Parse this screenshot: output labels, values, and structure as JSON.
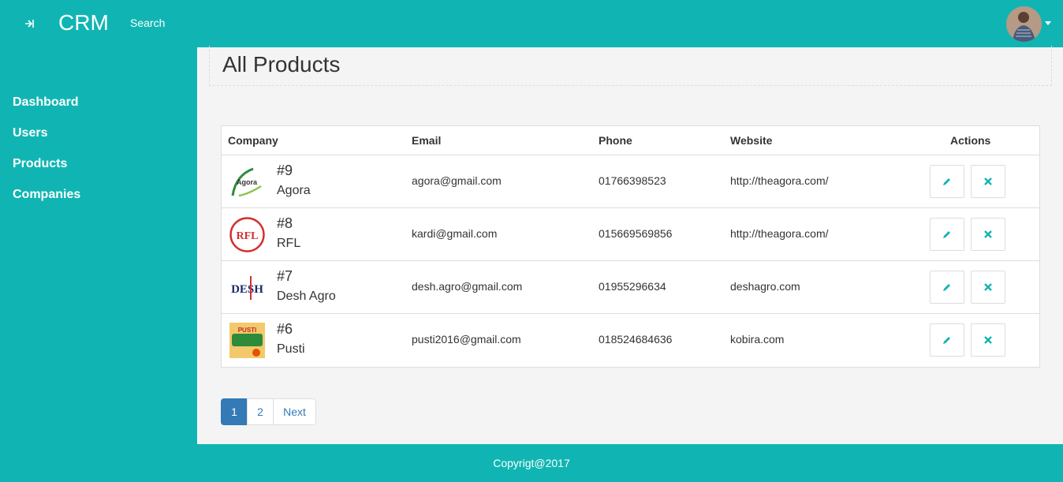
{
  "header": {
    "brand": "CRM",
    "search_label": "Search"
  },
  "colors": {
    "accent": "#10b5b3",
    "primary": "#337ab7"
  },
  "sidebar": {
    "items": [
      {
        "label": "Dashboard"
      },
      {
        "label": "Users"
      },
      {
        "label": "Products"
      },
      {
        "label": "Companies"
      }
    ]
  },
  "main": {
    "title": "All Products",
    "columns": [
      "Company",
      "Email",
      "Phone",
      "Website",
      "Actions"
    ],
    "rows": [
      {
        "id": "#9",
        "name": "Agora",
        "logo_text": "Agora",
        "email": "agora@gmail.com",
        "phone": "01766398523",
        "website": "http://theagora.com/"
      },
      {
        "id": "#8",
        "name": "RFL",
        "logo_text": "RFL",
        "email": "kardi@gmail.com",
        "phone": "015669569856",
        "website": "http://theagora.com/"
      },
      {
        "id": "#7",
        "name": "Desh Agro",
        "logo_text": "DESH",
        "email": "desh.agro@gmail.com",
        "phone": "01955296634",
        "website": "deshagro.com"
      },
      {
        "id": "#6",
        "name": "Pusti",
        "logo_text": "PUSTI",
        "email": "pusti2016@gmail.com",
        "phone": "018524684636",
        "website": "kobira.com"
      }
    ],
    "action_icons": {
      "edit": "pencil-icon",
      "delete": "close-icon"
    }
  },
  "pagination": {
    "pages": [
      "1",
      "2"
    ],
    "next": "Next",
    "current": "1"
  },
  "footer": {
    "text": "Copyrigt@2017"
  }
}
